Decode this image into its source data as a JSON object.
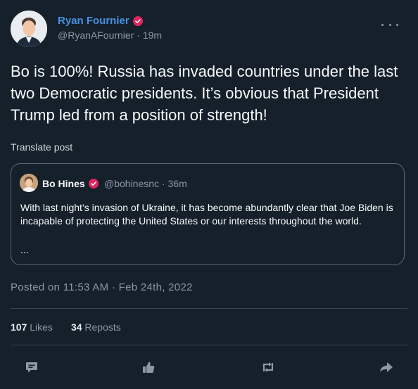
{
  "post": {
    "author_name": "Ryan Fournier",
    "handle": "@RyanAFournier",
    "separator": " · ",
    "time": "19m",
    "text": "Bo is 100%! Russia has invaded countries under the last two Democratic presidents. It’s obvious that President Trump led from a position of strength!",
    "translate_label": "Translate post"
  },
  "quote": {
    "author_name": "Bo Hines",
    "handle": "@bohinesnc",
    "separator": " · ",
    "time": "36m",
    "text": "With last night’s invasion of Ukraine, it has become abundantly clear that Joe Biden is incapable of protecting the United States or our interests throughout the world.",
    "ellipsis": "..."
  },
  "meta": {
    "posted_label": "Posted on 11:53 AM · Feb 24th, 2022"
  },
  "stats": {
    "likes_count": "107",
    "likes_label": "Likes",
    "reposts_count": "34",
    "reposts_label": "Reposts"
  },
  "icons": {
    "verified": "verified-badge-icon",
    "more": "more-options-icon",
    "reply": "reply-icon",
    "like": "like-icon",
    "repost": "repost-icon",
    "share": "share-icon"
  },
  "colors": {
    "background": "#15202b",
    "author_name": "#4a90e2",
    "verified_badge": "#e0245e",
    "muted": "#8b98a5",
    "text": "#f7f9f9",
    "border": "#5b6670"
  }
}
